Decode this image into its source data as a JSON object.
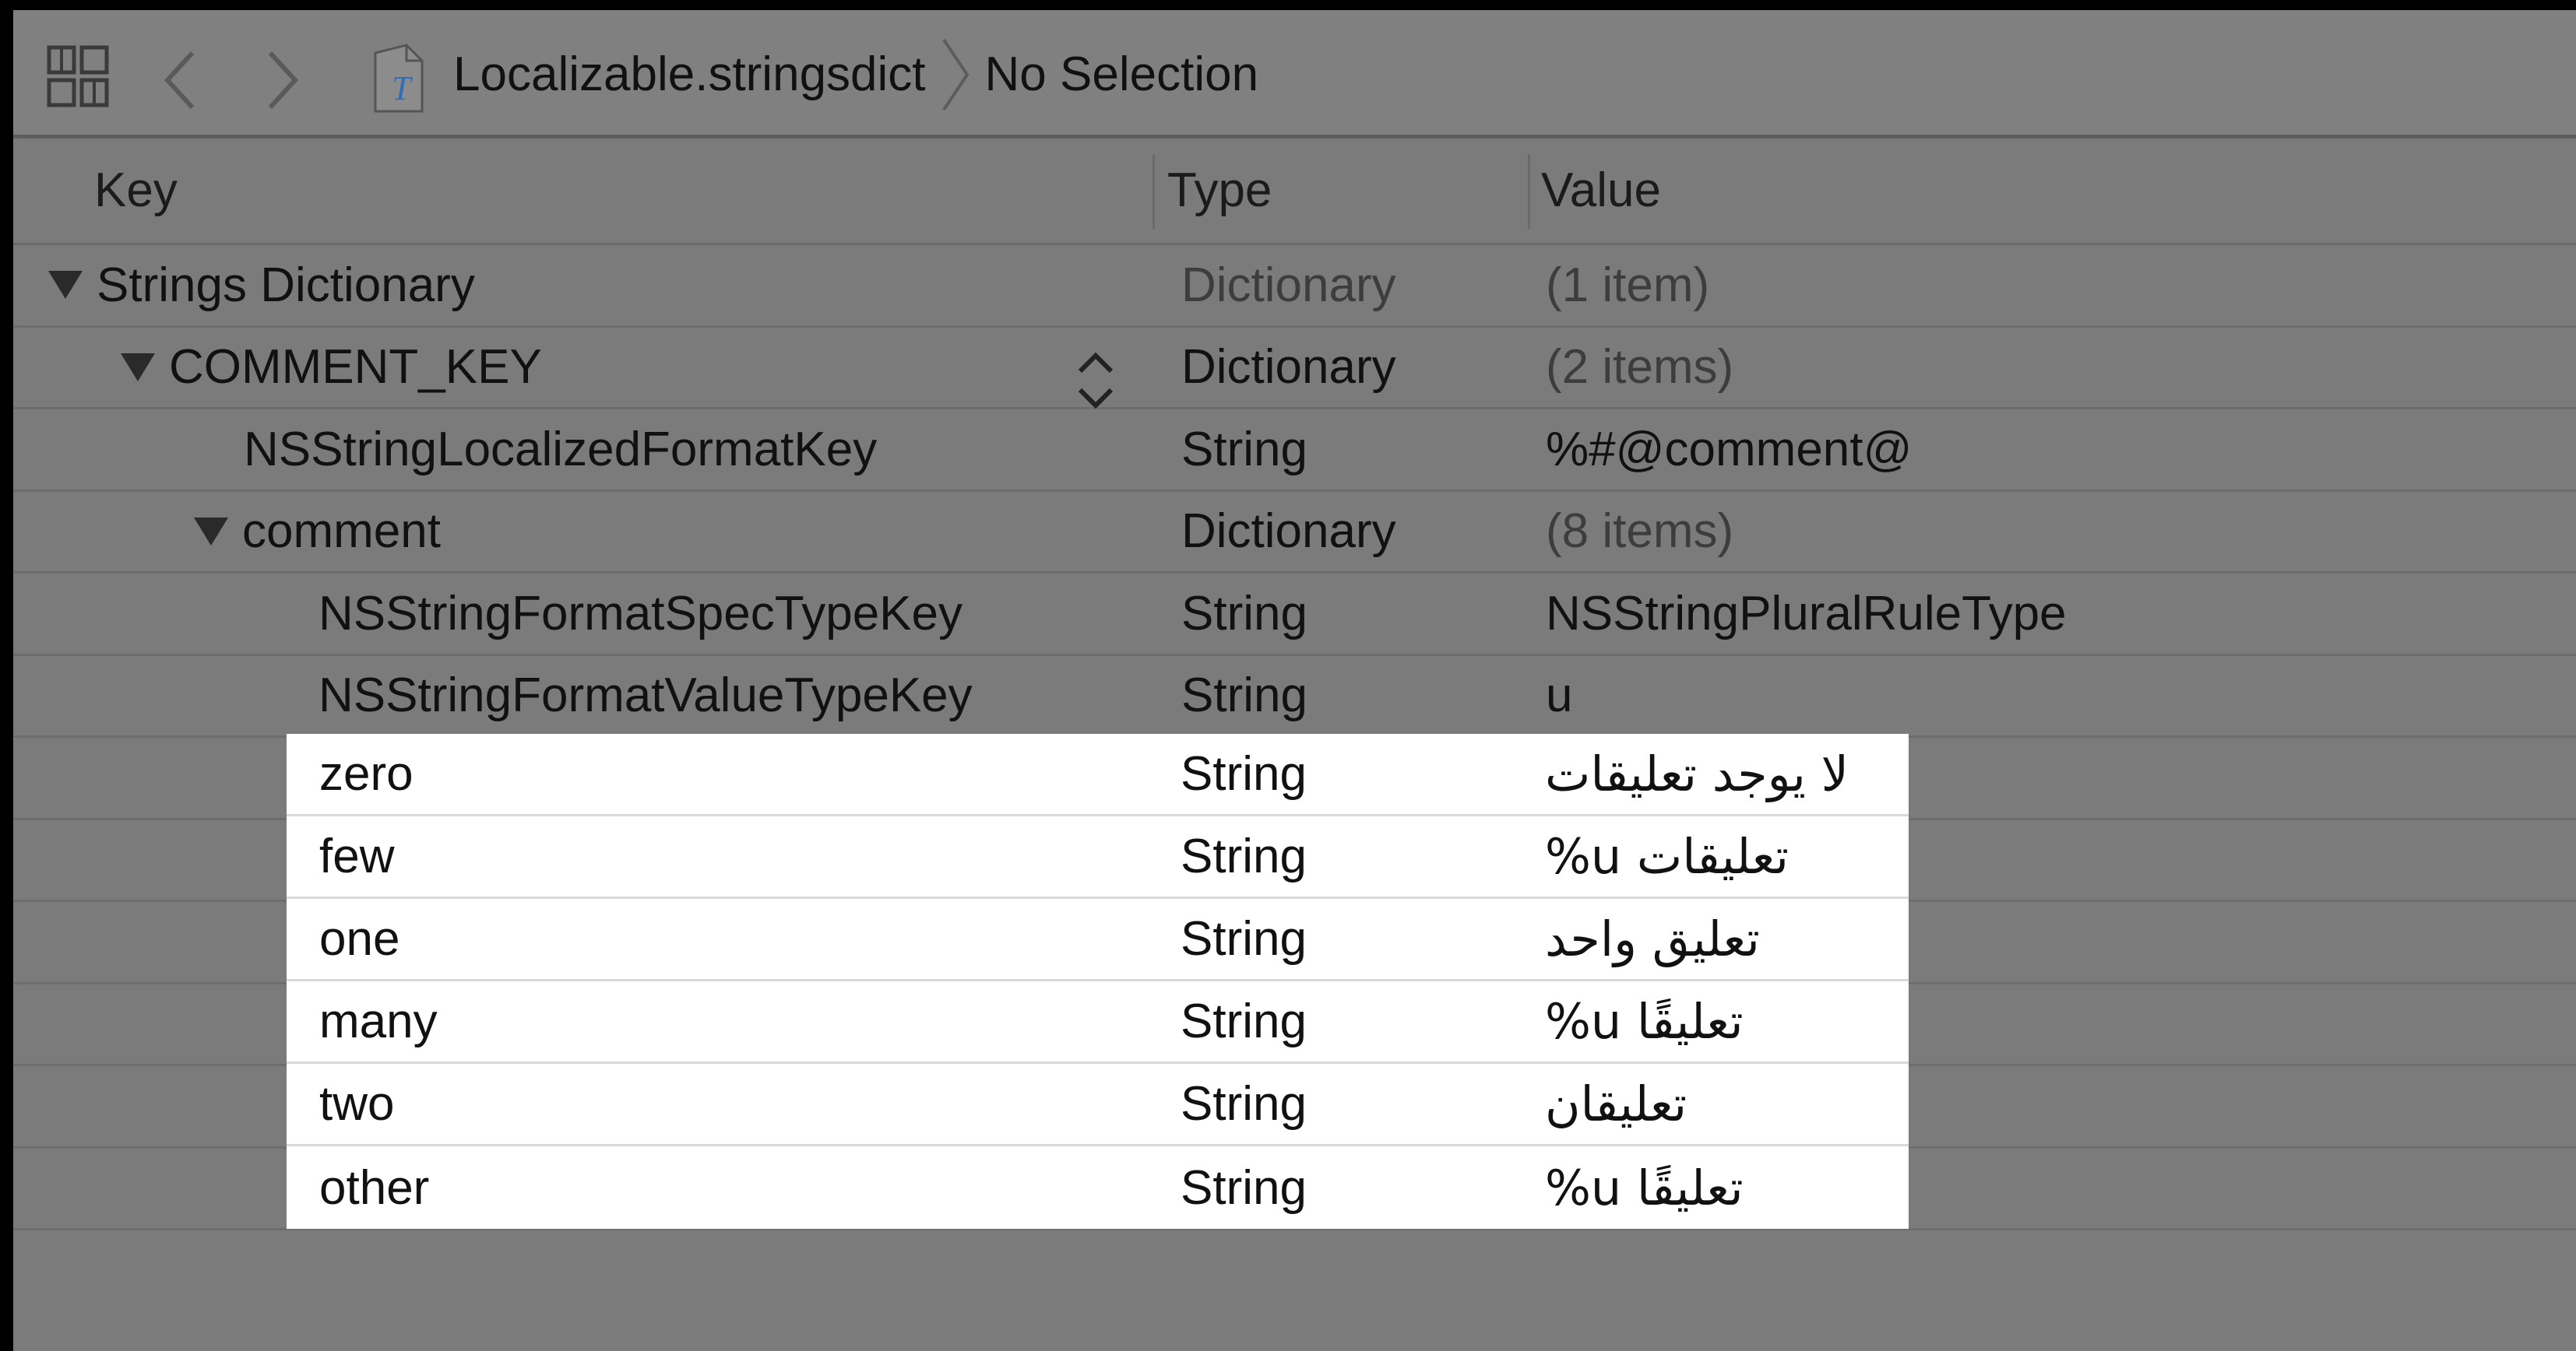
{
  "jumpbar": {
    "file": "Localizable.stringsdict",
    "selection": "No Selection"
  },
  "columns": {
    "key": "Key",
    "type": "Type",
    "value": "Value"
  },
  "rows": [
    {
      "key": "Strings Dictionary",
      "type": "Dictionary",
      "value": "(1 item)"
    },
    {
      "key": "COMMENT_KEY",
      "type": "Dictionary",
      "value": "(2 items)"
    },
    {
      "key": "NSStringLocalizedFormatKey",
      "type": "String",
      "value": "%#@comment@"
    },
    {
      "key": "comment",
      "type": "Dictionary",
      "value": "(8 items)"
    },
    {
      "key": "NSStringFormatSpecTypeKey",
      "type": "String",
      "value": "NSStringPluralRuleType"
    },
    {
      "key": "NSStringFormatValueTypeKey",
      "type": "String",
      "value": "u"
    }
  ],
  "plural_rows": [
    {
      "key": "zero",
      "type": "String",
      "value": "لا يوجد تعليقات"
    },
    {
      "key": "few",
      "type": "String",
      "value": "%u تعليقات"
    },
    {
      "key": "one",
      "type": "String",
      "value": "تعليق واحد"
    },
    {
      "key": "many",
      "type": "String",
      "value": "%u تعليقًا"
    },
    {
      "key": "two",
      "type": "String",
      "value": "تعليقان"
    },
    {
      "key": "other",
      "type": "String",
      "value": "%u تعليقًا"
    }
  ],
  "icons": [
    "grid-icon",
    "back-icon",
    "forward-icon",
    "strings-file-icon",
    "breadcrumb-separator-icon",
    "disclosure-triangle-icon",
    "stepper-icon"
  ],
  "colors": {
    "background": "#7b7b7b",
    "highlight": "#ffffff",
    "frame": "#000000"
  }
}
